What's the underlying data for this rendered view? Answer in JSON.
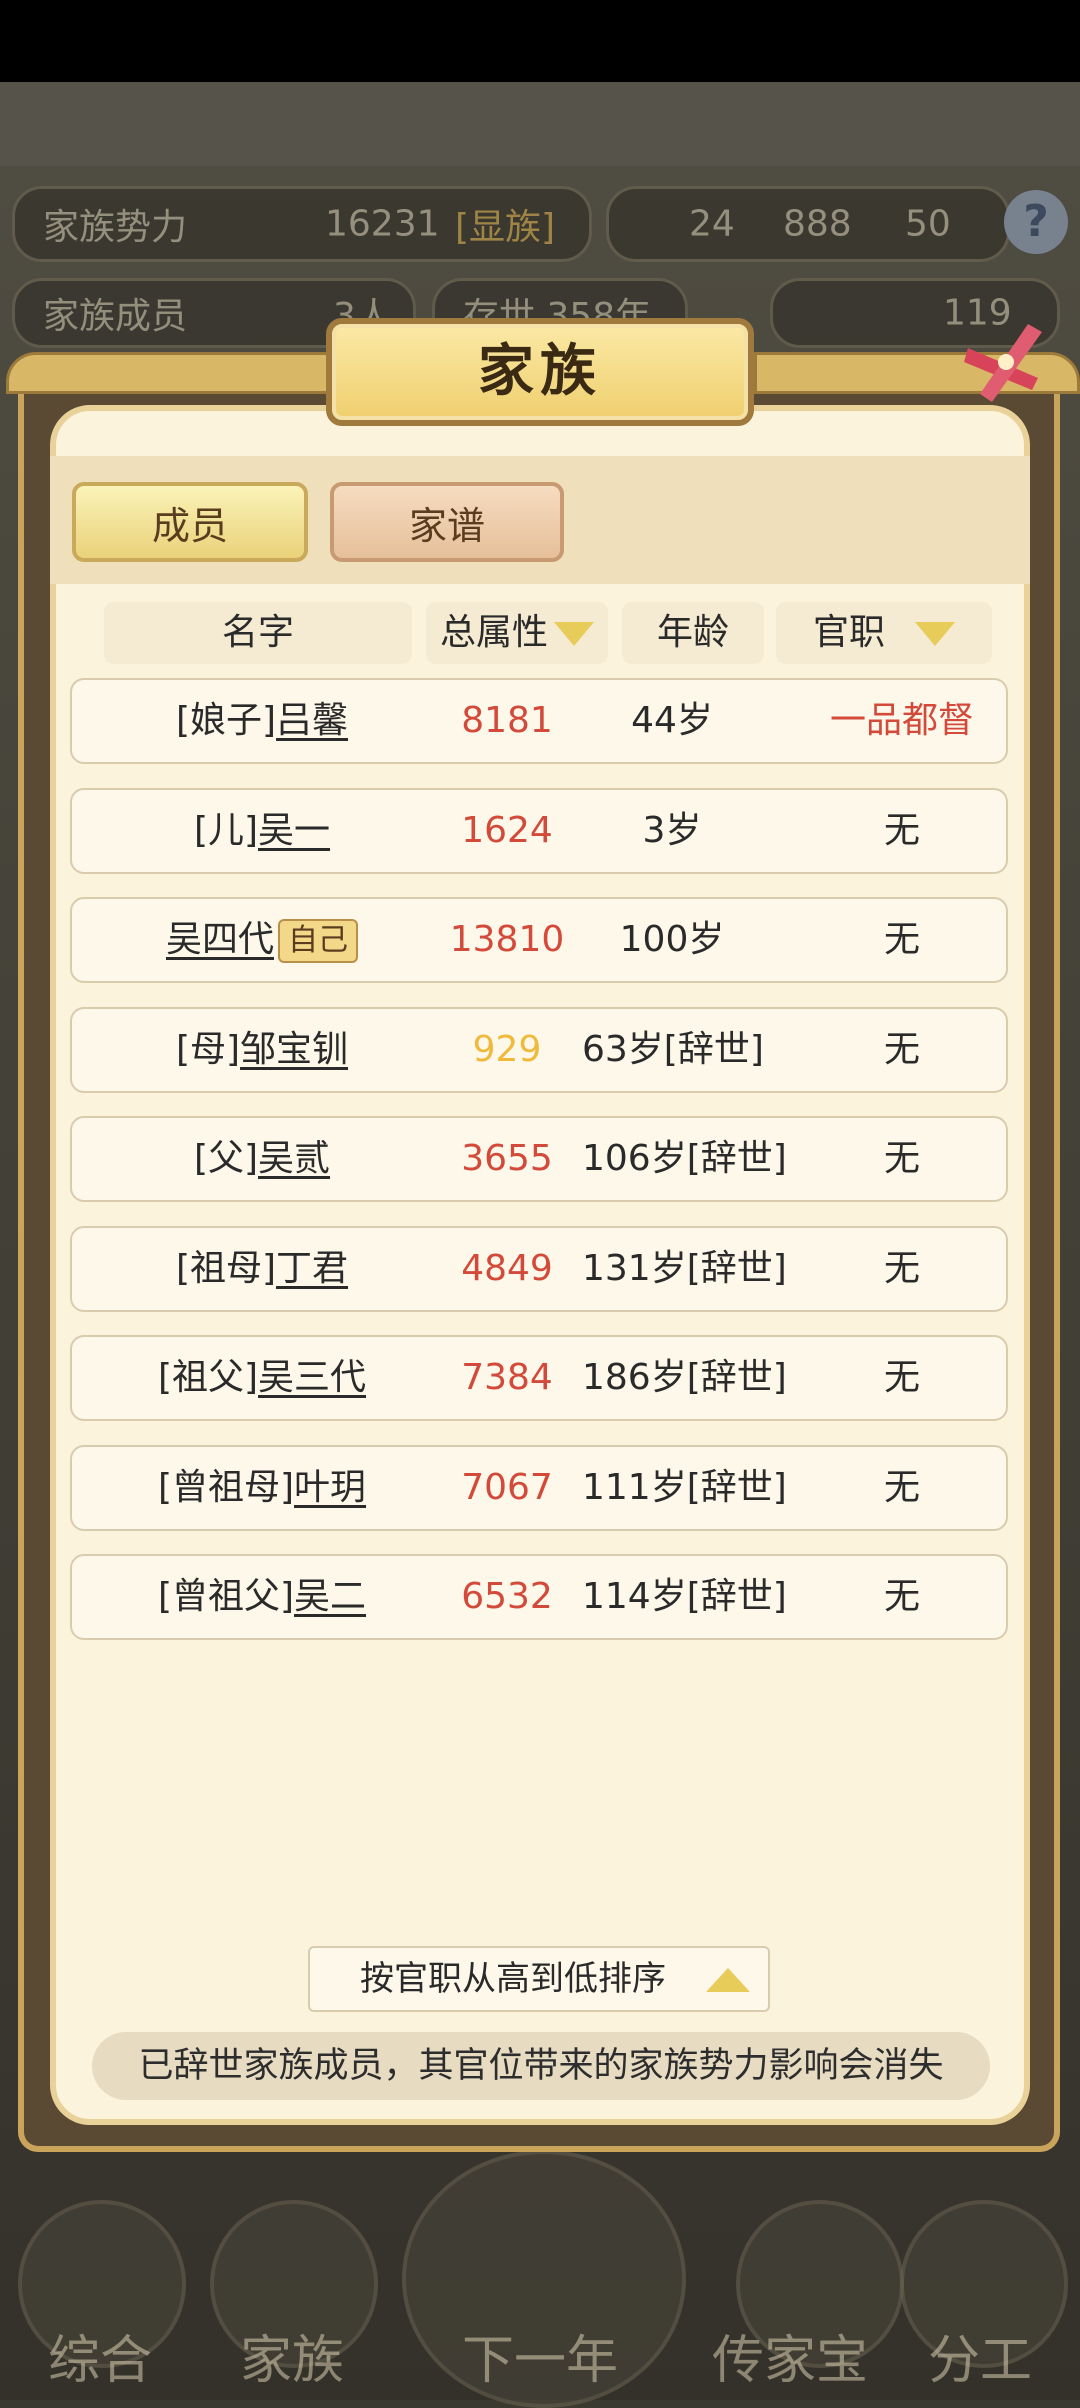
{
  "background_hud": {
    "family_power_label": "家族势力",
    "family_power_value": "16231",
    "family_rank": "[显族]",
    "currency_1": "24",
    "currency_2": "888",
    "currency_3": "50",
    "members_label": "家族成员",
    "members_value": "3人",
    "existence": "存世 358年",
    "gold_value": "119"
  },
  "modal": {
    "title": "家族",
    "tabs": [
      {
        "label": "成员",
        "active": true
      },
      {
        "label": "家谱",
        "active": false
      }
    ],
    "columns": {
      "name": "名字",
      "attr": "总属性",
      "age": "年龄",
      "office": "官职"
    },
    "members": [
      {
        "prefix": "[娘子]",
        "name": "吕馨",
        "badge": "",
        "attr": "8181",
        "attr_color": "red",
        "age": "44岁",
        "office": "一品都督",
        "office_color": "red"
      },
      {
        "prefix": "[儿]",
        "name": "吴一",
        "badge": "",
        "attr": "1624",
        "attr_color": "red",
        "age": "3岁",
        "office": "无",
        "office_color": "normal"
      },
      {
        "prefix": "",
        "name": "吴四代",
        "badge": "自己",
        "attr": "13810",
        "attr_color": "red",
        "age": "100岁",
        "office": "无",
        "office_color": "normal"
      },
      {
        "prefix": "[母]",
        "name": "邹宝钏",
        "badge": "",
        "attr": "929",
        "attr_color": "gold",
        "age": "63岁[辞世]",
        "office": "无",
        "office_color": "normal"
      },
      {
        "prefix": "[父]",
        "name": "吴贰",
        "badge": "",
        "attr": "3655",
        "attr_color": "red",
        "age": "106岁[辞世]",
        "office": "无",
        "office_color": "normal"
      },
      {
        "prefix": "[祖母]",
        "name": "丁君",
        "badge": "",
        "attr": "4849",
        "attr_color": "red",
        "age": "131岁[辞世]",
        "office": "无",
        "office_color": "normal"
      },
      {
        "prefix": "[祖父]",
        "name": "吴三代",
        "badge": "",
        "attr": "7384",
        "attr_color": "red",
        "age": "186岁[辞世]",
        "office": "无",
        "office_color": "normal"
      },
      {
        "prefix": "[曾祖母]",
        "name": "叶玥",
        "badge": "",
        "attr": "7067",
        "attr_color": "red",
        "age": "111岁[辞世]",
        "office": "无",
        "office_color": "normal"
      },
      {
        "prefix": "[曾祖父]",
        "name": "吴二",
        "badge": "",
        "attr": "6532",
        "attr_color": "red",
        "age": "114岁[辞世]",
        "office": "无",
        "office_color": "normal"
      }
    ],
    "sort_label": "按官职从高到低排序",
    "notice": "已辞世家族成员，其官位带来的家族势力影响会消失"
  },
  "bottom_nav": [
    {
      "label": "综合"
    },
    {
      "label": "家族"
    },
    {
      "label": "下一年"
    },
    {
      "label": "传家宝"
    },
    {
      "label": "分工"
    }
  ],
  "colors": {
    "red": "#d34a3a",
    "gold": "#f0b93a",
    "tab_active": "#e9d27a",
    "tab_inactive": "#e6bf9a"
  }
}
